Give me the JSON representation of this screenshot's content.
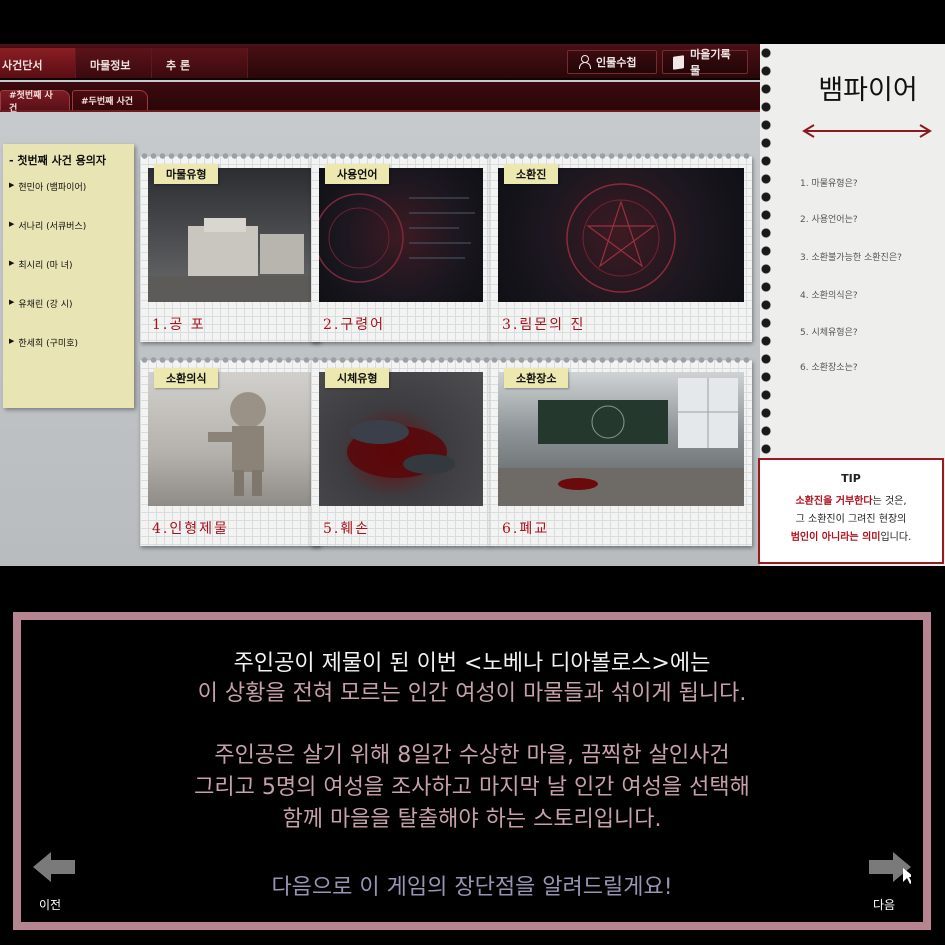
{
  "top_tabs": [
    "사건단서",
    "마물정보",
    "추 론"
  ],
  "buttons": {
    "characters": "인물수첩",
    "village": "마을기록물"
  },
  "sub_tabs": [
    "#첫번째 사건",
    "#두번째 사건"
  ],
  "suspects": {
    "title": "- 첫번째 사건 용의자",
    "items": [
      "현민아 (뱀파이어)",
      "서나리 (서큐버스)",
      "최시리 (마 녀)",
      "유채린 (강 시)",
      "한세희 (구미호)"
    ]
  },
  "cards": [
    {
      "label": "마물유형",
      "answer": "1.공 포"
    },
    {
      "label": "사용언어",
      "answer": "2.구령어"
    },
    {
      "label": "소환진",
      "answer": "3.림몬의 진"
    },
    {
      "label": "소환의식",
      "answer": "4.인형제물"
    },
    {
      "label": "시체유형",
      "answer": "5.훼손"
    },
    {
      "label": "소환장소",
      "answer": "6.폐교"
    }
  ],
  "notebook": {
    "title": "뱀파이어",
    "questions": [
      "1. 마물유형은?",
      "2. 사용언어는?",
      "3. 소환불가능한 소환진은?",
      "4. 소환의식은?",
      "5. 시체유형은?",
      "6. 소환장소는?"
    ]
  },
  "tip": {
    "title": "TIP",
    "line1_red": "소환진을 거부한다",
    "line1_rest": "는 것은,",
    "line2": "그 소환진이 그려진 현장의",
    "line3_red": "범인이 아니라는 의미",
    "line3_rest": "입니다."
  },
  "dialog": {
    "line1": "주인공이 제물이 된 이번 <노베나 디아볼로스>에는",
    "line2": "이 상황을 전혀 모르는 인간 여성이 마물들과 섞이게 됩니다.",
    "line3": "주인공은 살기 위해 8일간 수상한 마을, 끔찍한 살인사건",
    "line4": "그리고 5명의 여성을 조사하고 마지막 날 인간 여성을 선택해",
    "line5": "함께 마을을 탈출해야 하는 스토리입니다.",
    "line6": "다음으로 이 게임의 장단점을 알려드릴게요!",
    "prev_label": "이전",
    "next_label": "다음"
  },
  "colors": {
    "frame": "#b58591",
    "accent_red": "#a7121c",
    "dialog_pink": "#c7a1aa",
    "dialog_gray": "#9a94b4"
  }
}
